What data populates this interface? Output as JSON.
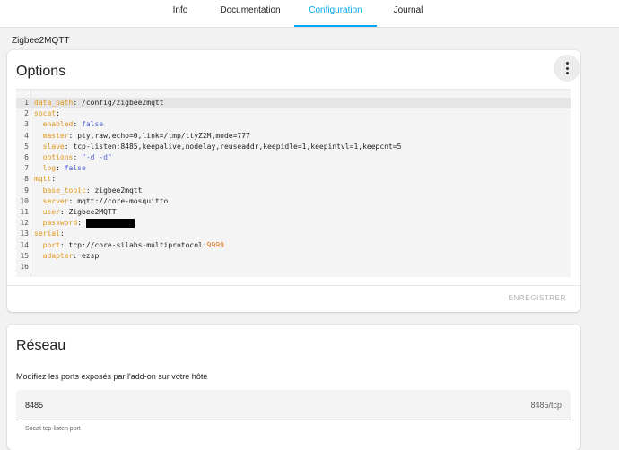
{
  "tabs": [
    {
      "label": "Info",
      "active": false
    },
    {
      "label": "Documentation",
      "active": false
    },
    {
      "label": "Configuration",
      "active": true
    },
    {
      "label": "Journal",
      "active": false
    }
  ],
  "breadcrumb": "Zigbee2MQTT",
  "options_card": {
    "title": "Options",
    "save_label": "ENREGISTRER",
    "code_lines": [
      {
        "num": "1",
        "key": "data_path",
        "indent": "",
        "value": "/config/zigbee2mqtt"
      },
      {
        "num": "2",
        "key": "socat",
        "indent": "",
        "value": ""
      },
      {
        "num": "3",
        "key": "enabled",
        "indent": "  ",
        "value": "false"
      },
      {
        "num": "4",
        "key": "master",
        "indent": "  ",
        "value": "pty,raw,echo=0,link=/tmp/ttyZ2M,mode=777"
      },
      {
        "num": "5",
        "key": "slave",
        "indent": "  ",
        "value": "tcp-listen:8485,keepalive,nodelay,reuseaddr,keepidle=1,keepintvl=1,keepcnt=5"
      },
      {
        "num": "6",
        "key": "options",
        "indent": "  ",
        "value": "\"-d -d\""
      },
      {
        "num": "7",
        "key": "log",
        "indent": "  ",
        "value": "false"
      },
      {
        "num": "8",
        "key": "mqtt",
        "indent": "",
        "value": ""
      },
      {
        "num": "9",
        "key": "base_topic",
        "indent": "  ",
        "value": "zigbee2mqtt"
      },
      {
        "num": "10",
        "key": "server",
        "indent": "  ",
        "value": "mqtt://core-mosquitto"
      },
      {
        "num": "11",
        "key": "user",
        "indent": "  ",
        "value": "Zigbee2MQTT"
      },
      {
        "num": "12",
        "key": "password",
        "indent": "  ",
        "value": ""
      },
      {
        "num": "13",
        "key": "serial",
        "indent": "",
        "value": ""
      },
      {
        "num": "14",
        "key": "port",
        "indent": "  ",
        "value": "tcp://core-silabs-multiprotocol:",
        "value_suffix": "9999"
      },
      {
        "num": "15",
        "key": "adapter",
        "indent": "  ",
        "value": "ezsp"
      },
      {
        "num": "16",
        "key": "",
        "indent": "",
        "value": ""
      }
    ]
  },
  "network_card": {
    "title": "Réseau",
    "description": "Modifiez les ports exposés par l'add-on sur votre hôte",
    "port_value": "8485",
    "port_suffix": "8485/tcp",
    "helper": "Socat tcp-listen port"
  },
  "colors": {
    "accent": "#03a9f4",
    "key": "#e0961a",
    "bool": "#4f64d8"
  }
}
